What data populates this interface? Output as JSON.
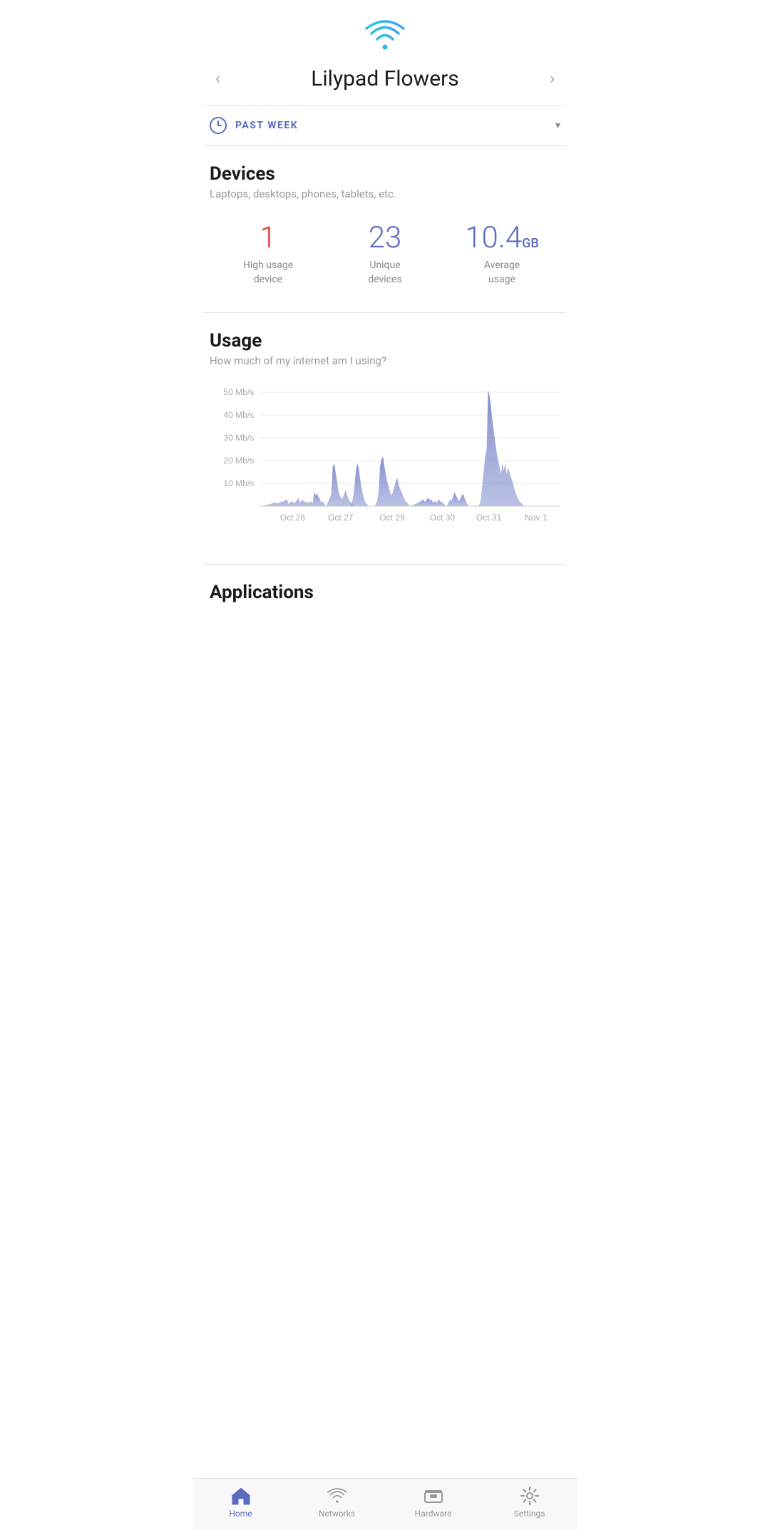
{
  "header": {
    "wifi_icon_label": "wifi-icon",
    "network_name": "Lilypad Flowers",
    "nav_prev": "‹",
    "nav_next": "›"
  },
  "period": {
    "label": "PAST WEEK",
    "dropdown_icon": "▾"
  },
  "devices": {
    "title": "Devices",
    "subtitle": "Laptops, desktops, phones, tablets, etc.",
    "stats": [
      {
        "value": "1",
        "unit": "",
        "label": "High usage\ndevice",
        "color": "red"
      },
      {
        "value": "23",
        "unit": "",
        "label": "Unique\ndevices",
        "color": "purple"
      },
      {
        "value": "10.4",
        "unit": "GB",
        "label": "Average\nusage",
        "color": "purple"
      }
    ]
  },
  "usage": {
    "title": "Usage",
    "subtitle": "How much of my internet am I using?",
    "y_labels": [
      "50 Mb/s",
      "40 Mb/s",
      "30 Mb/s",
      "20 Mb/s",
      "10 Mb/s",
      ""
    ],
    "x_labels": [
      "Oct 26",
      "Oct 27",
      "Oct 29",
      "Oct 30",
      "Oct 31",
      "Nov 1"
    ]
  },
  "applications": {
    "title": "Applications"
  },
  "bottom_nav": [
    {
      "id": "home",
      "label": "Home",
      "active": true
    },
    {
      "id": "networks",
      "label": "Networks",
      "active": false
    },
    {
      "id": "hardware",
      "label": "Hardware",
      "active": false
    },
    {
      "id": "settings",
      "label": "Settings",
      "active": false
    }
  ]
}
